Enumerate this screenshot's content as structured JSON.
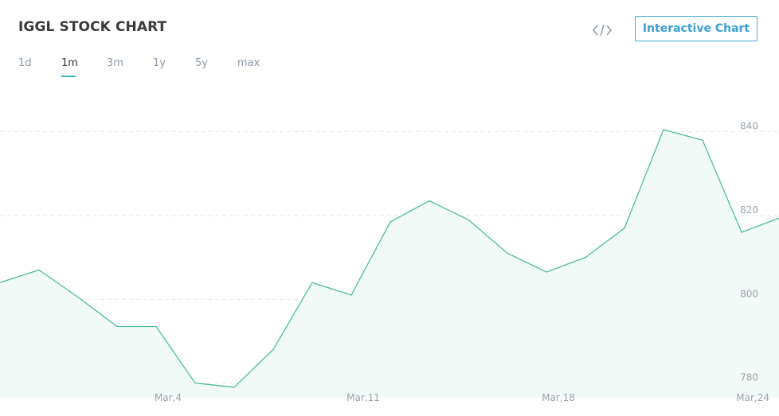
{
  "header": {
    "title": "IGGL STOCK CHART",
    "embed_icon": "code-embed-icon",
    "interactive_button": "Interactive Chart"
  },
  "tabs": [
    {
      "label": "1d",
      "active": false
    },
    {
      "label": "1m",
      "active": true
    },
    {
      "label": "3m",
      "active": false
    },
    {
      "label": "1y",
      "active": false
    },
    {
      "label": "5y",
      "active": false
    },
    {
      "label": "max",
      "active": false
    }
  ],
  "colors": {
    "line": "#4cc08f",
    "area": "#f2faf7",
    "grid": "#e2e6ea",
    "accent": "#36b6c9",
    "button": "#3b9fd6"
  },
  "chart_data": {
    "type": "area",
    "title": "",
    "xlabel": "",
    "ylabel": "",
    "x_tick_labels": [
      "Mar,4",
      "Mar,11",
      "Mar,18",
      "Mar,24"
    ],
    "y_tick_labels": [
      "780",
      "800",
      "820",
      "840"
    ],
    "ylim": [
      776.5,
      850
    ],
    "grid": true,
    "series": [
      {
        "values": [
          804,
          807,
          800.5,
          793.5,
          793.5,
          780,
          779,
          788,
          804,
          801,
          818.5,
          823.5,
          819,
          811,
          806.5,
          810,
          817,
          840.5,
          838,
          816,
          819.5
        ]
      }
    ]
  }
}
